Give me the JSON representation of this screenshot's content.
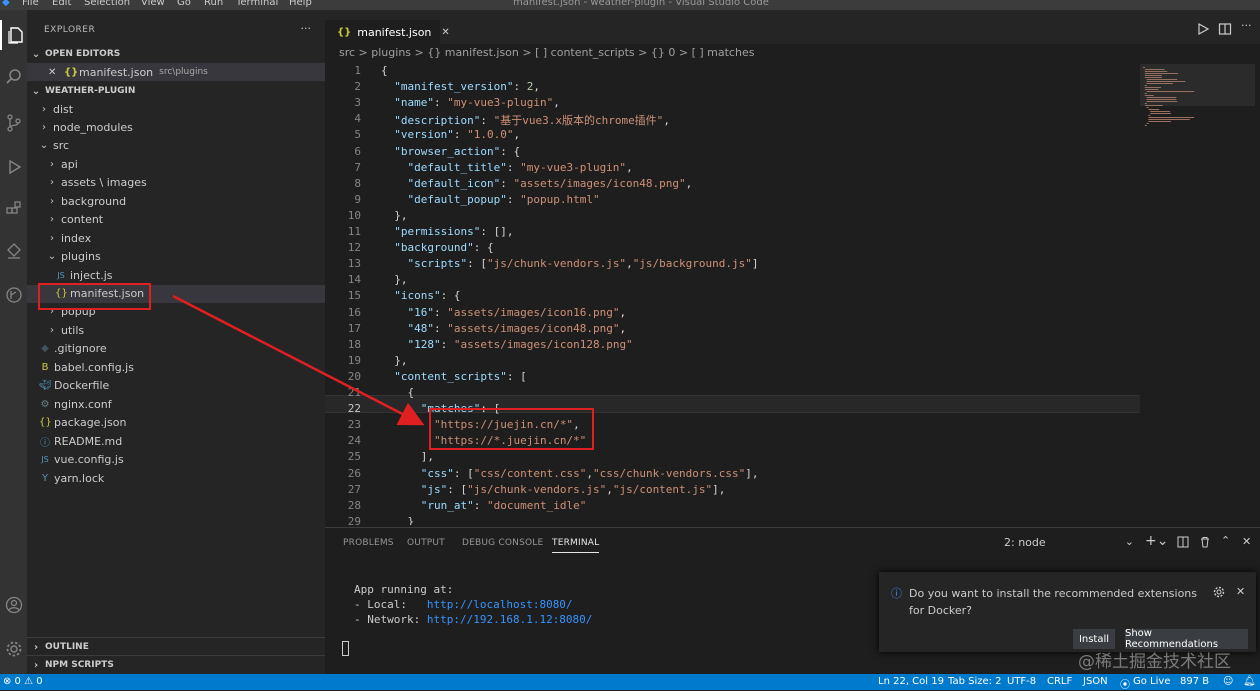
{
  "window": {
    "menu": [
      "File",
      "Edit",
      "Selection",
      "View",
      "Go",
      "Run",
      "Terminal",
      "Help"
    ],
    "title": "manifest.json - weather-plugin - Visual Studio Code"
  },
  "sidebar": {
    "title": "EXPLORER",
    "more": "···",
    "open_editors_label": "OPEN EDITORS",
    "open_editor": {
      "close": "✕",
      "name": "manifest.json",
      "path": "src\\plugins"
    },
    "project_label": "WEATHER-PLUGIN",
    "tree": [
      {
        "name": "dist",
        "kind": "folder"
      },
      {
        "name": "node_modules",
        "kind": "folder"
      },
      {
        "name": "src",
        "kind": "folder-open"
      },
      {
        "name": "api",
        "kind": "folder"
      },
      {
        "name": "assets \\ images",
        "kind": "folder"
      },
      {
        "name": "background",
        "kind": "folder"
      },
      {
        "name": "content",
        "kind": "folder"
      },
      {
        "name": "index",
        "kind": "folder"
      },
      {
        "name": "plugins",
        "kind": "folder-open"
      },
      {
        "name": "inject.js",
        "kind": "js"
      },
      {
        "name": "manifest.json",
        "kind": "json"
      },
      {
        "name": "popup",
        "kind": "folder"
      },
      {
        "name": "utils",
        "kind": "folder"
      },
      {
        "name": ".gitignore",
        "kind": "git"
      },
      {
        "name": "babel.config.js",
        "kind": "babel"
      },
      {
        "name": "Dockerfile",
        "kind": "docker"
      },
      {
        "name": "nginx.conf",
        "kind": "gear"
      },
      {
        "name": "package.json",
        "kind": "json"
      },
      {
        "name": "README.md",
        "kind": "info"
      },
      {
        "name": "vue.config.js",
        "kind": "js"
      },
      {
        "name": "yarn.lock",
        "kind": "yarn"
      }
    ],
    "outline_label": "OUTLINE",
    "npm_label": "NPM SCRIPTS"
  },
  "editor": {
    "tab": {
      "icon": "{}",
      "name": "manifest.json",
      "close": "✕"
    },
    "breadcrumb": "src > plugins > {} manifest.json > [ ] content_scripts > {} 0 > [ ] matches",
    "lines": [
      "{",
      "  \"manifest_version\": 2,",
      "  \"name\": \"my-vue3-plugin\",",
      "  \"description\": \"基于vue3.x版本的chrome插件\",",
      "  \"version\": \"1.0.0\",",
      "  \"browser_action\": {",
      "    \"default_title\": \"my-vue3-plugin\",",
      "    \"default_icon\": \"assets/images/icon48.png\",",
      "    \"default_popup\": \"popup.html\"",
      "  },",
      "  \"permissions\": [],",
      "  \"background\": {",
      "    \"scripts\": [\"js/chunk-vendors.js\",\"js/background.js\"]",
      "  },",
      "  \"icons\": {",
      "    \"16\": \"assets/images/icon16.png\",",
      "    \"48\": \"assets/images/icon48.png\",",
      "    \"128\": \"assets/images/icon128.png\"",
      "  },",
      "  \"content_scripts\": [",
      "    {",
      "      \"matches\": [",
      "        \"https://juejin.cn/*\",",
      "        \"https://*.juejin.cn/*\"",
      "      ],",
      "      \"css\": [\"css/content.css\",\"css/chunk-vendors.css\"],",
      "      \"js\": [\"js/chunk-vendors.js\",\"js/content.js\"],",
      "      \"run_at\": \"document_idle\"",
      "    }",
      "  }"
    ],
    "current_line": 22
  },
  "panel": {
    "tabs": [
      "PROBLEMS",
      "OUTPUT",
      "DEBUG CONSOLE",
      "TERMINAL"
    ],
    "active_tab": "TERMINAL",
    "terminal_select": "2: node",
    "terminal": {
      "line1": "App running at:",
      "local_label": "- Local:   ",
      "local_url": "http://localhost:8080/",
      "network_label": "- Network: ",
      "network_url": "http://192.168.1.12:8080/"
    }
  },
  "notification": {
    "text": "Do you want to install the recommended extensions for Docker?",
    "install": "Install",
    "show": "Show Recommendations"
  },
  "status": {
    "errors": "⊗ 0 ⚠ 0",
    "position": "Ln 22, Col 19",
    "tab_size": "Tab Size: 2",
    "encoding": "UTF-8",
    "eol": "CRLF",
    "language": "JSON",
    "golive": "Go Live",
    "size": "897 B"
  },
  "watermark": "@稀土掘金技术社区",
  "colors": {
    "accent": "#007acc",
    "annotation": "#e02020"
  }
}
